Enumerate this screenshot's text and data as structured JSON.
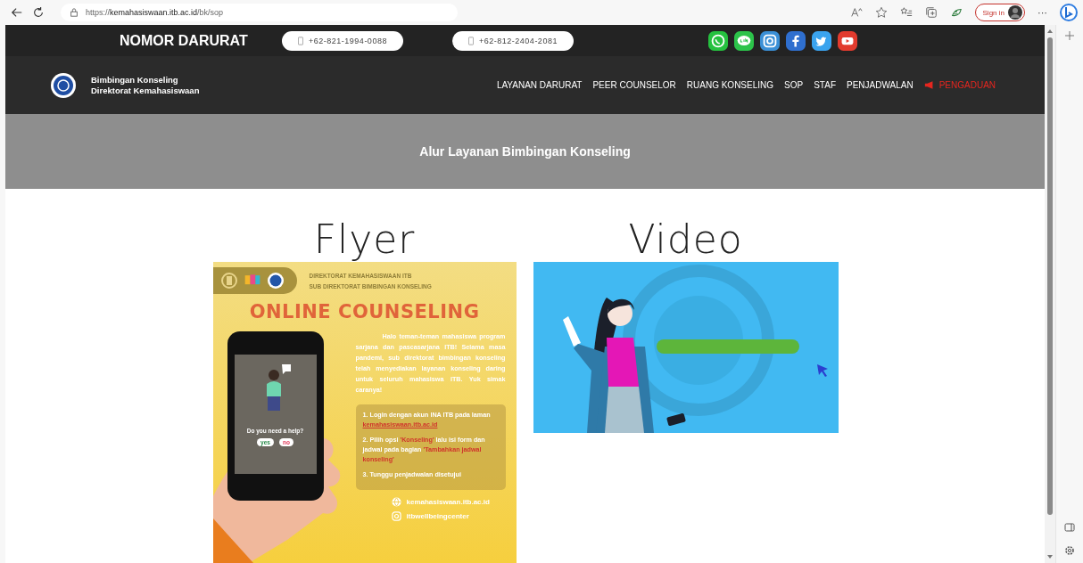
{
  "browser": {
    "url_scheme": "https://",
    "url_host": "kemahasiswaan.itb.ac.id",
    "url_path": "/bk/sop",
    "sign_in": "Sign in",
    "more": "···"
  },
  "topbar": {
    "title": "NOMOR DARURAT",
    "phones": [
      "+62-821-1994-0088",
      "+62-812-2404-2081"
    ],
    "socials": [
      {
        "kind": "whatsapp"
      },
      {
        "kind": "line"
      },
      {
        "kind": "instagram"
      },
      {
        "kind": "facebook"
      },
      {
        "kind": "twitter"
      },
      {
        "kind": "youtube"
      }
    ]
  },
  "nav": {
    "brand": [
      "Bimbingan Konseling",
      "Direktorat Kemahasiswaan"
    ],
    "items": [
      {
        "label": "LAYANAN DARURAT",
        "kind": "plain"
      },
      {
        "label": "PEER COUNSELOR",
        "kind": "plain"
      },
      {
        "label": "RUANG KONSELING",
        "kind": "plain"
      },
      {
        "label": "SOP",
        "kind": "plain"
      },
      {
        "label": "STAF",
        "kind": "plain"
      },
      {
        "label": "PENJADWALAN",
        "kind": "plain"
      },
      {
        "label": "PENGADUAN",
        "kind": "alert"
      }
    ]
  },
  "banner": "Alur Layanan Bimbingan Konseling",
  "sections": [
    {
      "heading": "Flyer"
    },
    {
      "heading": "Video"
    }
  ],
  "flyer": {
    "org": [
      "DIREKTORAT KEMAHASISWAAN ITB",
      "SUB DIREKTORAT BIMBINGAN KONSELING"
    ],
    "title": "ONLINE COUNSELING",
    "intro": "Halo teman-teman mahasiswa program sarjana dan pascasarjana ITB! Selama masa pandemi, sub direktorat bimbingan konseling telah menyediakan layanan konseling daring untuk seluruh mahasiswa ITB. Yuk simak caranya!",
    "question": "Do you need a help?",
    "yes": "yes",
    "no": "no",
    "steps": [
      [
        {
          "text": "1. Login dengan akun INA ITB pada laman ",
          "kind": "plain"
        },
        {
          "text": "kemahasiswaan.itb.ac.id",
          "kind": "link"
        }
      ],
      [
        {
          "text": "2. Pilih opsi ",
          "kind": "plain"
        },
        {
          "text": "'Konseling'",
          "kind": "accent"
        },
        {
          "text": " lalu isi form dan jadwal pada bagian ",
          "kind": "plain"
        },
        {
          "text": "'Tambahkan jadwal konseling'",
          "kind": "accent"
        }
      ],
      [
        {
          "text": "3. Tunggu penjadwalan disetujui",
          "kind": "plain"
        }
      ]
    ],
    "contacts": [
      {
        "kind": "web",
        "text": "kemahasiswaan.itb.ac.id"
      },
      {
        "kind": "instagram",
        "text": "itbwellbeingcenter"
      }
    ]
  }
}
